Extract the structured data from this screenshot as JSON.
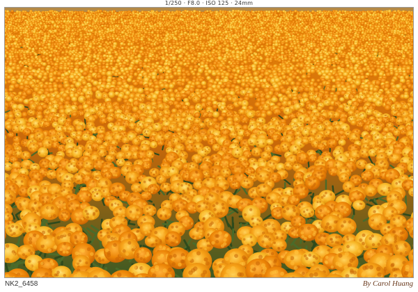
{
  "exif_caption": "1/250 · F8.0 · ISO 125 · 24mm",
  "file_name": "NK2_6458",
  "signature": "By Carol Huang",
  "scene": {
    "subject": "marigold field",
    "colors": {
      "flower_orange": "#f39a12",
      "flower_deep": "#e07b05",
      "flower_yellow": "#f7b21f",
      "foliage": "#34521f",
      "foliage_dark": "#1f3314",
      "far_field": "#e98f10",
      "frame_border": "#9a9a9a"
    }
  }
}
